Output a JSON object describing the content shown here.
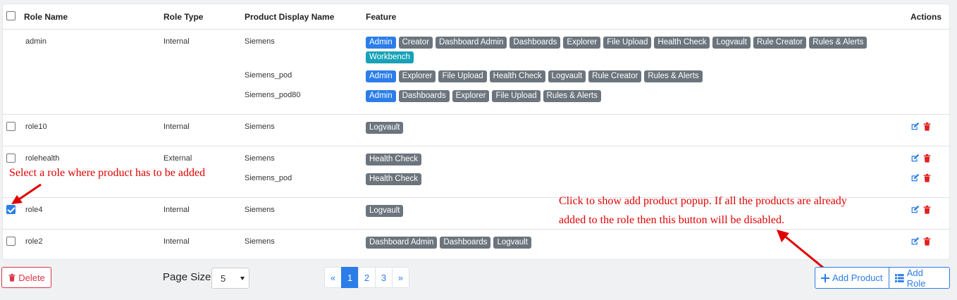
{
  "table": {
    "headers": {
      "role_name": "Role Name",
      "role_type": "Role Type",
      "product_display_name": "Product Display Name",
      "feature": "Feature",
      "actions": "Actions"
    },
    "rows": [
      {
        "name": "admin",
        "type": "Internal",
        "checked": false,
        "has_checkbox": false,
        "products": [
          {
            "name": "Siemens",
            "features": [
              "Admin",
              "Creator",
              "Dashboard Admin",
              "Dashboards",
              "Explorer",
              "File Upload",
              "Health Check",
              "Logvault",
              "Rule Creator",
              "Rules & Alerts",
              "Workbench"
            ]
          },
          {
            "name": "Siemens_pod",
            "features": [
              "Admin",
              "Explorer",
              "File Upload",
              "Health Check",
              "Logvault",
              "Rule Creator",
              "Rules & Alerts"
            ]
          },
          {
            "name": "Siemens_pod80",
            "features": [
              "Admin",
              "Dashboards",
              "Explorer",
              "File Upload",
              "Rules & Alerts"
            ]
          }
        ]
      },
      {
        "name": "role10",
        "type": "Internal",
        "checked": false,
        "has_checkbox": true,
        "products": [
          {
            "name": "Siemens",
            "features": [
              "Logvault"
            ]
          }
        ]
      },
      {
        "name": "rolehealth",
        "type": "External",
        "checked": false,
        "has_checkbox": true,
        "products": [
          {
            "name": "Siemens",
            "features": [
              "Health Check"
            ]
          },
          {
            "name": "Siemens_pod",
            "features": [
              "Health Check"
            ]
          }
        ]
      },
      {
        "name": "role4",
        "type": "Internal",
        "checked": true,
        "has_checkbox": true,
        "products": [
          {
            "name": "Siemens",
            "features": [
              "Logvault"
            ]
          }
        ]
      },
      {
        "name": "role2",
        "type": "Internal",
        "checked": false,
        "has_checkbox": true,
        "products": [
          {
            "name": "Siemens",
            "features": [
              "Dashboard Admin",
              "Dashboards",
              "Logvault"
            ]
          }
        ]
      }
    ]
  },
  "annotations": {
    "select_role": "Select a role where product has to be added",
    "add_product_line1": "Click to show add product popup. If all the products are already",
    "add_product_line2": "added to the role then this button will be disabled."
  },
  "footer": {
    "delete_label": "Delete",
    "page_size_label": "Page Size",
    "page_size_value": "5",
    "pagination": [
      "«",
      "1",
      "2",
      "3",
      "»"
    ],
    "current_page": "1",
    "add_product_label": "Add Product",
    "add_role_label": "Add Role"
  },
  "colors": {
    "primary": "#2b7de9",
    "tag_gray": "#6c757d",
    "tag_teal": "#17a2b8",
    "danger": "#dc3545",
    "annotation": "#e00000"
  },
  "icons": {
    "edit": "edit-icon",
    "trash": "trash-icon",
    "plus": "plus-icon",
    "list": "list-icon",
    "delete_trash": "trash-icon"
  }
}
